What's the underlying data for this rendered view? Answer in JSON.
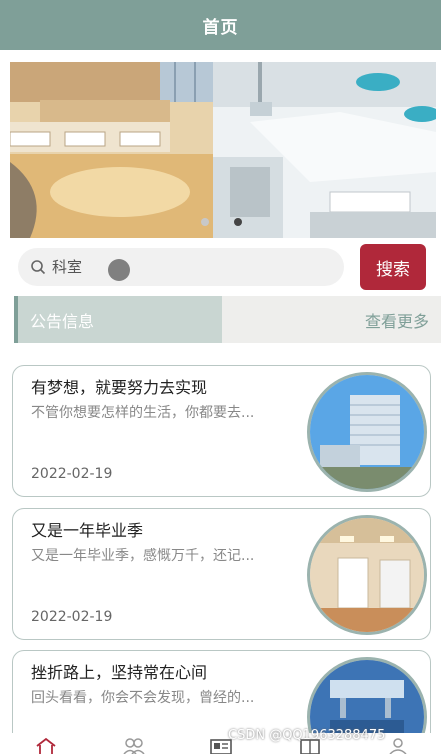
{
  "header": {
    "title": "首页"
  },
  "banner": {
    "slides": [
      "hospital-ward-photo",
      "operating-room-photo"
    ],
    "active_index": 1
  },
  "search": {
    "placeholder": "科室",
    "button_label": "搜索"
  },
  "notice": {
    "title": "公告信息",
    "more_label": "查看更多"
  },
  "articles": [
    {
      "title": "有梦想，就要努力去实现",
      "excerpt": "不管你想要怎样的生活，你都要去...",
      "date": "2022-02-19"
    },
    {
      "title": "又是一年毕业季",
      "excerpt": "又是一年毕业季，感慨万千，还记...",
      "date": "2022-02-19"
    },
    {
      "title": "挫折路上，坚持常在心间",
      "excerpt": "回头看看，你会不会发现，曾经的...",
      "date": ""
    }
  ],
  "tabbar": {
    "icons": [
      "home-icon",
      "people-icon",
      "news-icon",
      "building-icon",
      "user-icon"
    ]
  },
  "watermark": {
    "text": "CSDN @QQ1963288475"
  },
  "colors": {
    "primary": "#7f9f98",
    "accent": "#b0283a",
    "notice_bg": "#c9d6d2"
  }
}
